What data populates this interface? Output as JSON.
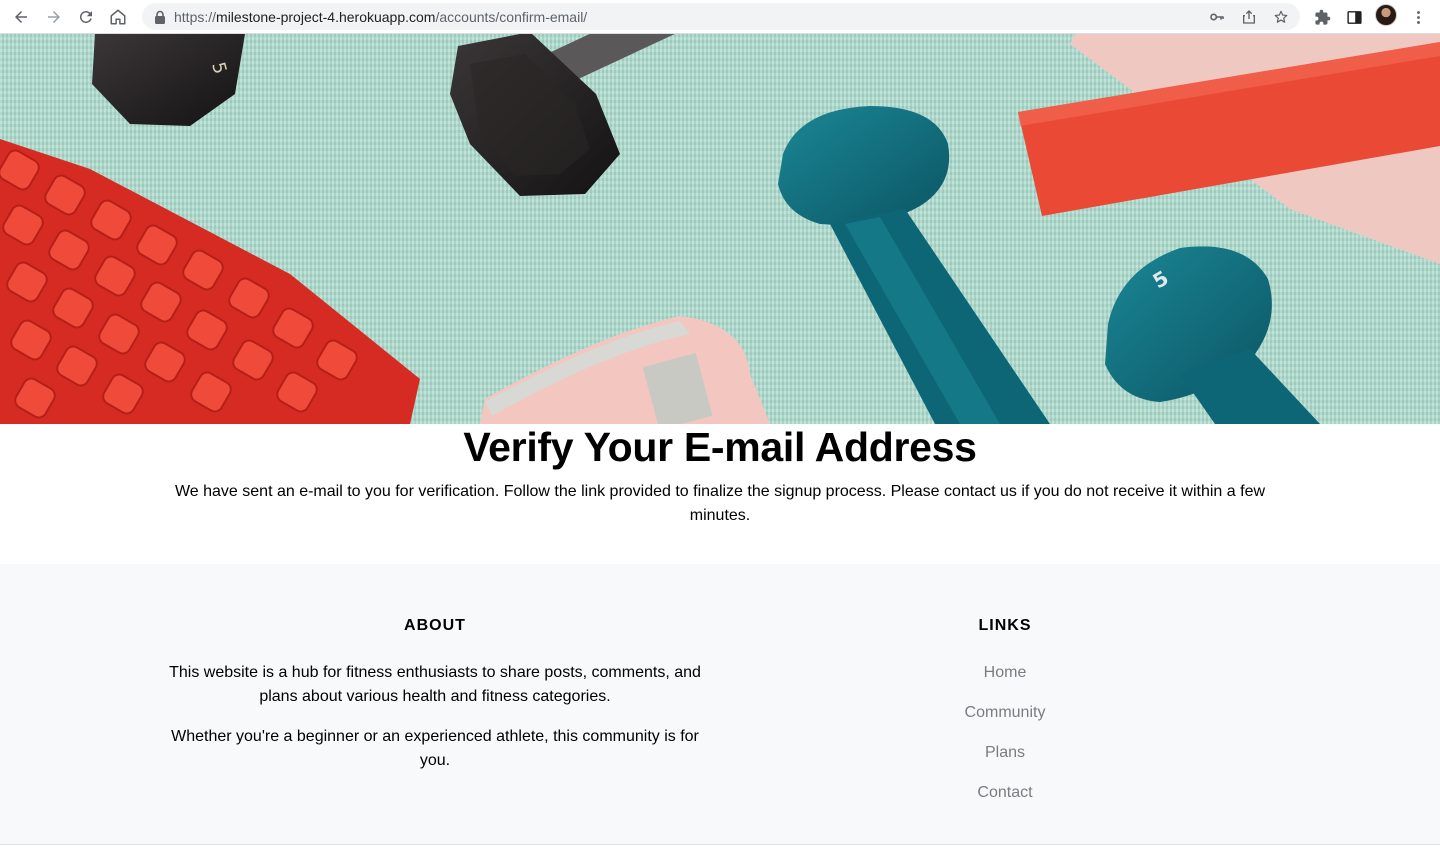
{
  "browser": {
    "url_scheme": "https://",
    "url_host": "milestone-project-4.herokuapp.com",
    "url_path": "/accounts/confirm-email/",
    "icons": [
      "back-icon",
      "forward-icon",
      "reload-icon",
      "home-icon",
      "lock-icon",
      "key-icon",
      "share-icon",
      "star-icon",
      "extensions-icon",
      "side-panel-icon",
      "profile-avatar",
      "more-menu-icon"
    ]
  },
  "main": {
    "title": "Verify Your E-mail Address",
    "message": "We have sent an e-mail to you for verification. Follow the link provided to finalize the signup process. Please contact us if you do not receive it within a few minutes."
  },
  "footer": {
    "about": {
      "heading": "ABOUT",
      "paragraph_1": "This website is a hub for fitness enthusiasts to share posts, comments, and plans about various health and fitness categories.",
      "paragraph_2": "Whether you're a beginner or an experienced athlete, this community is for you."
    },
    "links": {
      "heading": "LINKS",
      "items": [
        {
          "label": "Home"
        },
        {
          "label": "Community"
        },
        {
          "label": "Plans"
        },
        {
          "label": "Contact"
        }
      ]
    }
  },
  "colors": {
    "mat": "#a9d9cb",
    "foam_roller": "#e8352b",
    "dumbbell_teal": "#0f6f7e",
    "dumbbell_black": "#1e1c1d",
    "band_red": "#ea4a35",
    "band_pink": "#efc9c1",
    "footer_bg": "#f8f9fa",
    "link_gray": "#7a7d80"
  }
}
